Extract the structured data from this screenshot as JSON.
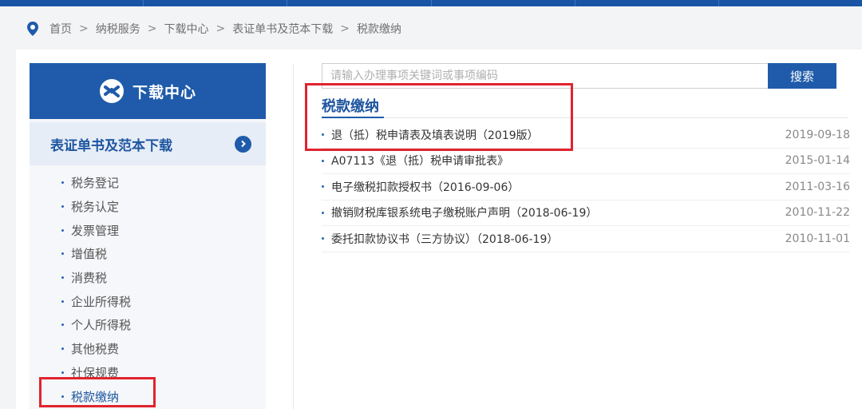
{
  "breadcrumb": [
    "首页",
    "纳税服务",
    "下载中心",
    "表证单书及范本下载",
    "税款缴纳"
  ],
  "breadcrumb_separator": ">",
  "sidebar": {
    "title": "下载中心",
    "category": "表证单书及范本下载",
    "items": [
      "税务登记",
      "税务认定",
      "发票管理",
      "增值税",
      "消费税",
      "企业所得税",
      "个人所得税",
      "其他税费",
      "社保规费",
      "税款缴纳"
    ],
    "active_item": "税款缴纳"
  },
  "search": {
    "placeholder": "请输入办理事项关键词或事项编码",
    "button_label": "搜索"
  },
  "section_title": "税款缴纳",
  "documents": [
    {
      "name": "退（抵）税申请表及填表说明（2019版）",
      "date": "2019-09-18"
    },
    {
      "name": "A07113《退（抵）税申请审批表》",
      "date": "2015-01-14"
    },
    {
      "name": "电子缴税扣款授权书（2016-09-06）",
      "date": "2011-03-16"
    },
    {
      "name": "撤销财税库银系统电子缴税账户声明（2018-06-19）",
      "date": "2010-11-22"
    },
    {
      "name": "委托扣款协议书（三方协议）（2018-06-19）",
      "date": "2010-11-01"
    }
  ],
  "colors": {
    "brand": "#1f5baa",
    "highlight": "#e0242e"
  }
}
